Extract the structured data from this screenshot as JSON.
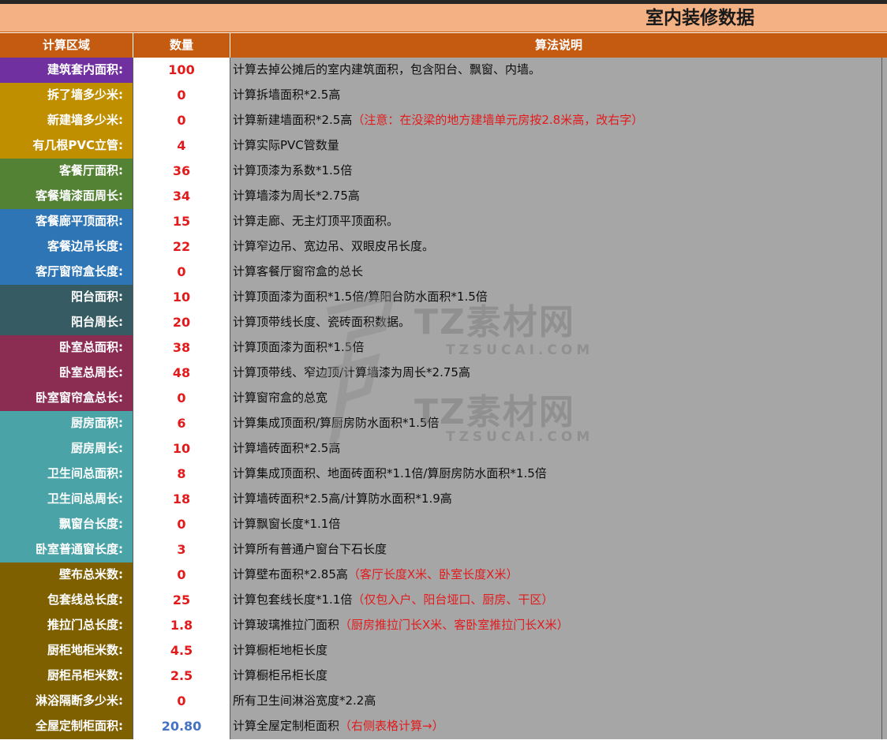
{
  "title": "室内装修数据",
  "headers": {
    "area": "计算区域",
    "qty": "数量",
    "method": "算法说明"
  },
  "rows": [
    {
      "label": "建筑套内面积:",
      "value": "100",
      "desc": "计算去掉公摊后的室内建筑面积，包含阳台、飘窗、内墙。",
      "note": "",
      "color": "#7030a0"
    },
    {
      "label": "拆了墙多少米:",
      "value": "0",
      "desc": "计算拆墙面积*2.5高",
      "note": "",
      "color": "#bf8f00"
    },
    {
      "label": "新建墙多少米:",
      "value": "0",
      "desc": "计算新建墙面积*2.5高",
      "note": "（注意：在没梁的地方建墙单元房按2.8米高，改右字）",
      "color": "#bf8f00"
    },
    {
      "label": "有几根PVC立管:",
      "value": "4",
      "desc": "计算实际PVC管数量",
      "note": "",
      "color": "#bf8f00"
    },
    {
      "label": "客餐厅面积:",
      "value": "36",
      "desc": "计算顶漆为系数*1.5倍",
      "note": "",
      "color": "#548235"
    },
    {
      "label": "客餐墙漆面周长:",
      "value": "34",
      "desc": "计算墙漆为周长*2.75高",
      "note": "",
      "color": "#548235"
    },
    {
      "label": "客餐廊平顶面积:",
      "value": "15",
      "desc": "计算走廊、无主灯顶平顶面积。",
      "note": "",
      "color": "#2e75b6"
    },
    {
      "label": "客餐边吊长度:",
      "value": "22",
      "desc": "计算窄边吊、宽边吊、双眼皮吊长度。",
      "note": "",
      "color": "#2e75b6"
    },
    {
      "label": "客厅窗帘盒长度:",
      "value": "0",
      "desc": "计算客餐厅窗帘盒的总长",
      "note": "",
      "color": "#2e75b6"
    },
    {
      "label": "阳台面积:",
      "value": "10",
      "desc": "计算顶面漆为面积*1.5倍/算阳台防水面积*1.5倍",
      "note": "",
      "color": "#375b62"
    },
    {
      "label": "阳台周长:",
      "value": "20",
      "desc": "计算顶带线长度、瓷砖面积数据。",
      "note": "",
      "color": "#375b62"
    },
    {
      "label": "卧室总面积:",
      "value": "38",
      "desc": "计算顶面漆为面积*1.5倍",
      "note": "",
      "color": "#8b2d52"
    },
    {
      "label": "卧室总周长:",
      "value": "48",
      "desc": "计算顶带线、窄边顶/计算墙漆为周长*2.75高",
      "note": "",
      "color": "#8b2d52"
    },
    {
      "label": "卧室窗帘盒总长:",
      "value": "0",
      "desc": "计算窗帘盒的总宽",
      "note": "",
      "color": "#8b2d52"
    },
    {
      "label": "厨房面积:",
      "value": "6",
      "desc": "计算集成顶面积/算厨房防水面积*1.5倍",
      "note": "",
      "color": "#4aa3a7"
    },
    {
      "label": "厨房周长:",
      "value": "10",
      "desc": "计算墙砖面积*2.5高",
      "note": "",
      "color": "#4aa3a7"
    },
    {
      "label": "卫生间总面积:",
      "value": "8",
      "desc": "计算集成顶面积、地面砖面积*1.1倍/算厨房防水面积*1.5倍",
      "note": "",
      "color": "#4aa3a7"
    },
    {
      "label": "卫生间总周长:",
      "value": "18",
      "desc": "计算墙砖面积*2.5高/计算防水面积*1.9高",
      "note": "",
      "color": "#4aa3a7"
    },
    {
      "label": "飘窗台长度:",
      "value": "0",
      "desc": "计算飘窗长度*1.1倍",
      "note": "",
      "color": "#4aa3a7"
    },
    {
      "label": "卧室普通窗长度:",
      "value": "3",
      "desc": "计算所有普通户窗台下石长度",
      "note": "",
      "color": "#4aa3a7"
    },
    {
      "label": "壁布总米数:",
      "value": "0",
      "desc": "计算壁布面积*2.85高",
      "note": "（客厅长度X米、卧室长度X米）",
      "color": "#7f6000"
    },
    {
      "label": "包套线总长度:",
      "value": "25",
      "desc": "计算包套线长度*1.1倍",
      "note": "（仅包入户、阳台垭口、厨房、干区）",
      "color": "#7f6000"
    },
    {
      "label": "推拉门总长度:",
      "value": "1.8",
      "desc": "计算玻璃推拉门面积",
      "note": "（厨房推拉门长X米、客卧室推拉门长X米）",
      "color": "#7f6000"
    },
    {
      "label": "厨柜地柜米数:",
      "value": "4.5",
      "desc": "计算橱柜地柜长度",
      "note": "",
      "color": "#7f6000"
    },
    {
      "label": "厨柜吊柜米数:",
      "value": "2.5",
      "desc": "计算橱柜吊柜长度",
      "note": "",
      "color": "#7f6000"
    },
    {
      "label": "淋浴隔断多少米:",
      "value": "0",
      "desc": "所有卫生间淋浴宽度*2.2高",
      "note": "",
      "color": "#7f6000"
    },
    {
      "label": "全屋定制柜面积:",
      "value": "20.80",
      "desc": "计算全屋定制柜面积",
      "note": "（右侧表格计算→）",
      "color": "#7f6000",
      "value_color": "blue"
    }
  ],
  "watermark": {
    "brand": "TZ素材网",
    "site": "TZSUCAI.COM"
  }
}
